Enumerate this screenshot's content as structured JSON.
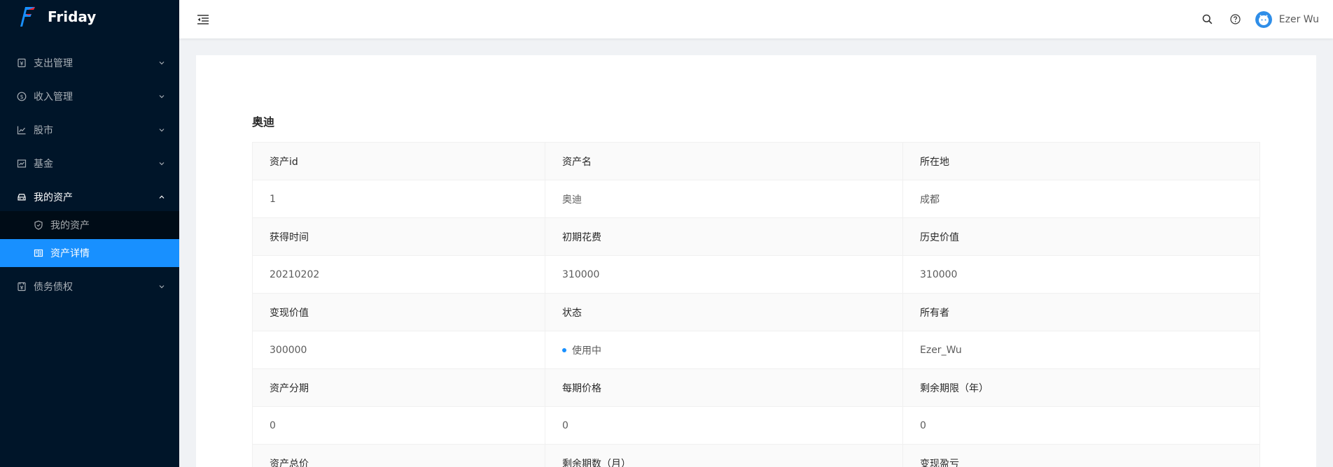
{
  "app": {
    "name": "Friday"
  },
  "sidebar": {
    "items": [
      {
        "label": "支出管理",
        "icon": "wallet-icon"
      },
      {
        "label": "收入管理",
        "icon": "dollar-circle-icon"
      },
      {
        "label": "股市",
        "icon": "line-chart-icon"
      },
      {
        "label": "基金",
        "icon": "fund-icon"
      },
      {
        "label": "我的资产",
        "icon": "car-icon",
        "open": true,
        "children": [
          {
            "label": "我的资产",
            "icon": "shield-icon"
          },
          {
            "label": "资产详情",
            "icon": "profile-icon",
            "active": true
          }
        ]
      },
      {
        "label": "债务债权",
        "icon": "account-book-icon"
      }
    ]
  },
  "header": {
    "user_name": "Ezer Wu"
  },
  "detail": {
    "title": "奥迪",
    "rows": [
      {
        "labels": [
          "资产id",
          "资产名",
          "所在地"
        ],
        "values": [
          "1",
          "奥迪",
          "成都"
        ]
      },
      {
        "labels": [
          "获得时间",
          "初期花费",
          "历史价值"
        ],
        "values": [
          "20210202",
          "310000",
          "310000"
        ]
      },
      {
        "labels": [
          "变现价值",
          "状态",
          "所有者"
        ],
        "values": [
          "300000",
          "使用中",
          "Ezer_Wu"
        ]
      },
      {
        "labels": [
          "资产分期",
          "每期价格",
          "剩余期限（年）"
        ],
        "values": [
          "0",
          "0",
          "0"
        ]
      },
      {
        "labels": [
          "资产总价",
          "剩余期数（月）",
          "变现盈亏"
        ],
        "values": [
          "",
          "",
          ""
        ]
      }
    ]
  },
  "colors": {
    "sider_bg": "#001529",
    "submenu_bg": "#000c17",
    "primary": "#1890ff",
    "status_dot": "#1890ff"
  }
}
